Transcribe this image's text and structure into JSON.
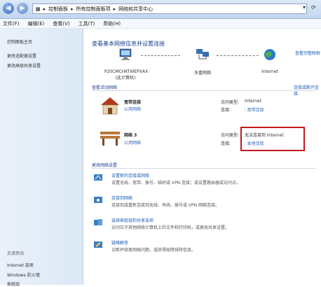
{
  "address": {
    "crumbs": [
      "控制面板",
      "所有控制面板项",
      "网络和共享中心"
    ]
  },
  "menu": {
    "file": "文件(F)",
    "edit": "编辑(E)",
    "view": "查看(V)",
    "tools": "工具(T)",
    "help": "帮助(H)"
  },
  "sidebar": {
    "home": "控制面板主页",
    "adapter": "更改适配器设置",
    "advanced": "更改高级共享设置",
    "see_also": "另请参阅",
    "internet_options": "Internet 选项",
    "firewall": "Windows 防火墙",
    "homegroup": "家庭组"
  },
  "main": {
    "title": "查看基本网络信息并设置连接",
    "full_map": "查看完整映射",
    "nodes": {
      "computer": "P20CMCHKTWEPXAX",
      "computer_sub": "(此计算机)",
      "network": "多重网络",
      "internet": "Internet"
    },
    "active_header": "查看活动网络",
    "connect_disconnect": "连接或断开连接",
    "broadband": {
      "name": "宽带连接",
      "type": "公用网络",
      "access_label": "访问类型:",
      "access_value": "Internet",
      "conn_label": "连接:",
      "conn_value": "宽带连接"
    },
    "network3": {
      "name": "网络  3",
      "type": "公用网络",
      "access_label": "访问类型:",
      "access_value": "无法连接到 Internet",
      "conn_label": "连接:",
      "conn_value": "本地连接"
    },
    "change_header": "更改网络设置",
    "tasks": [
      {
        "title": "设置新的连接或网络",
        "desc": "设置无线、宽带、拨号、临时或 VPN 连接；或设置路由器或访问点。"
      },
      {
        "title": "连接到网络",
        "desc": "连接到或重新连接到无线、有线、拨号或 VPN 网络连接。"
      },
      {
        "title": "选择家庭组和共享选项",
        "desc": "访问位于其他网络计算机上的文件和打印机，或更改共享设置。"
      },
      {
        "title": "疑难解答",
        "desc": "诊断并修复网络问题，或获得故障排除信息。"
      }
    ]
  },
  "colors": {
    "highlight_box": "#c2181e",
    "link": "#1a5fb4",
    "title": "#1f3f8f"
  }
}
